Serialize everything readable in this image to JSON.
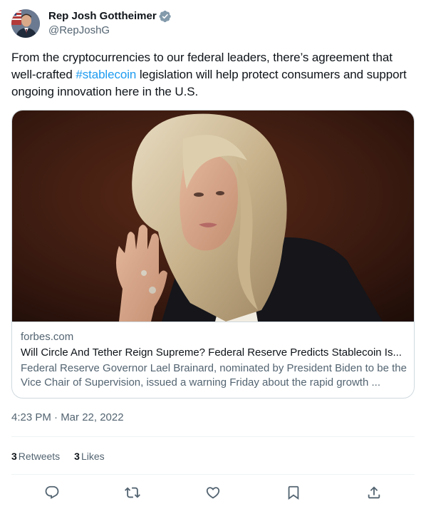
{
  "author": {
    "display_name": "Rep Josh Gottheimer",
    "handle": "@RepJoshG",
    "verified_icon": "verified-badge-icon"
  },
  "tweet": {
    "text_before": "From the cryptocurrencies to our federal leaders, there’s agreement that well-crafted ",
    "hashtag": "#stablecoin",
    "text_after": " legislation will help protect consumers and support ongoing innovation here in the U.S."
  },
  "card": {
    "domain": "forbes.com",
    "title": "Will Circle And Tether Reign Supreme? Federal Reserve Predicts Stablecoin Is...",
    "description": "Federal Reserve Governor Lael Brainard, nominated by President Biden to be the Vice Chair of Supervision, issued a warning Friday about the rapid growth ..."
  },
  "timestamp": "4:23 PM · Mar 22, 2022",
  "stats": {
    "retweets_count": "3",
    "retweets_label": "Retweets",
    "likes_count": "3",
    "likes_label": "Likes"
  },
  "actions": [
    "reply-icon",
    "retweet-icon",
    "like-icon",
    "bookmark-icon",
    "share-icon"
  ],
  "colors": {
    "accent": "#1d9bf0",
    "text": "#0f1419",
    "secondary": "#536471",
    "border": "#cfd9de"
  }
}
